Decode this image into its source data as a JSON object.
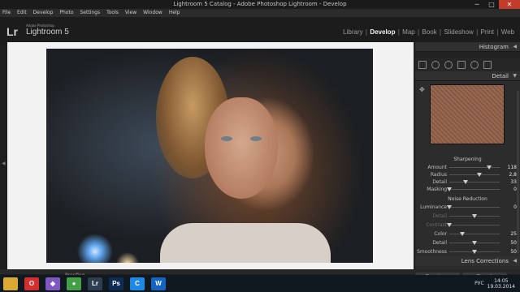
{
  "window": {
    "title": "Lightroom 5 Catalog - Adobe Photoshop Lightroom - Develop",
    "minimize": "─",
    "maximize": "□",
    "close": "✕"
  },
  "menu": [
    "File",
    "Edit",
    "Develop",
    "Photo",
    "Settings",
    "Tools",
    "View",
    "Window",
    "Help"
  ],
  "branding": {
    "logo": "Lr",
    "vendor": "Adobe Photoshop",
    "product": "Lightroom 5"
  },
  "modules": [
    "Library",
    "Develop",
    "Map",
    "Book",
    "Slideshow",
    "Print",
    "Web"
  ],
  "active_module": "Develop",
  "right_panel": {
    "histogram_title": "Histogram",
    "detail_title": "Detail",
    "sharpening_title": "Sharpening",
    "sharpening": [
      {
        "label": "Amount",
        "value": "118",
        "level": 0.79
      },
      {
        "label": "Radius",
        "value": "2,8",
        "level": 0.6
      },
      {
        "label": "Detail",
        "value": "33",
        "level": 0.33
      },
      {
        "label": "Masking",
        "value": "0",
        "level": 0.0
      }
    ],
    "noise_title": "Noise Reduction",
    "noise": [
      {
        "label": "Luminance",
        "value": "0",
        "level": 0.0,
        "dim": false
      },
      {
        "label": "Detail",
        "value": "",
        "level": 0.5,
        "dim": true
      },
      {
        "label": "Contrast",
        "value": "",
        "level": 0.0,
        "dim": true
      },
      {
        "label": "Color",
        "value": "25",
        "level": 0.25,
        "dim": false
      },
      {
        "label": "Detail",
        "value": "50",
        "level": 0.5,
        "dim": false
      },
      {
        "label": "Smoothness",
        "value": "50",
        "level": 0.5,
        "dim": false
      }
    ],
    "lens_title": "Lens Corrections"
  },
  "bottom": {
    "filmstrip_label": "Proofing",
    "previous": "Previous",
    "reset": "Reset"
  },
  "taskbar": {
    "apps": [
      {
        "name": "file-explorer",
        "glyph": "",
        "color": "#d9a933"
      },
      {
        "name": "opera",
        "glyph": "O",
        "color": "#d32f2f"
      },
      {
        "name": "visual-studio",
        "glyph": "◆",
        "color": "#7e57c2"
      },
      {
        "name": "chrome",
        "glyph": "●",
        "color": "#43a047"
      },
      {
        "name": "lightroom",
        "glyph": "Lr",
        "color": "#2c3e50"
      },
      {
        "name": "photoshop",
        "glyph": "Ps",
        "color": "#0d2c54"
      },
      {
        "name": "ccleaner",
        "glyph": "C",
        "color": "#1e88e5"
      },
      {
        "name": "word",
        "glyph": "W",
        "color": "#1565c0"
      }
    ],
    "lang": "РУС",
    "time": "14:05",
    "date": "19.03.2014"
  }
}
